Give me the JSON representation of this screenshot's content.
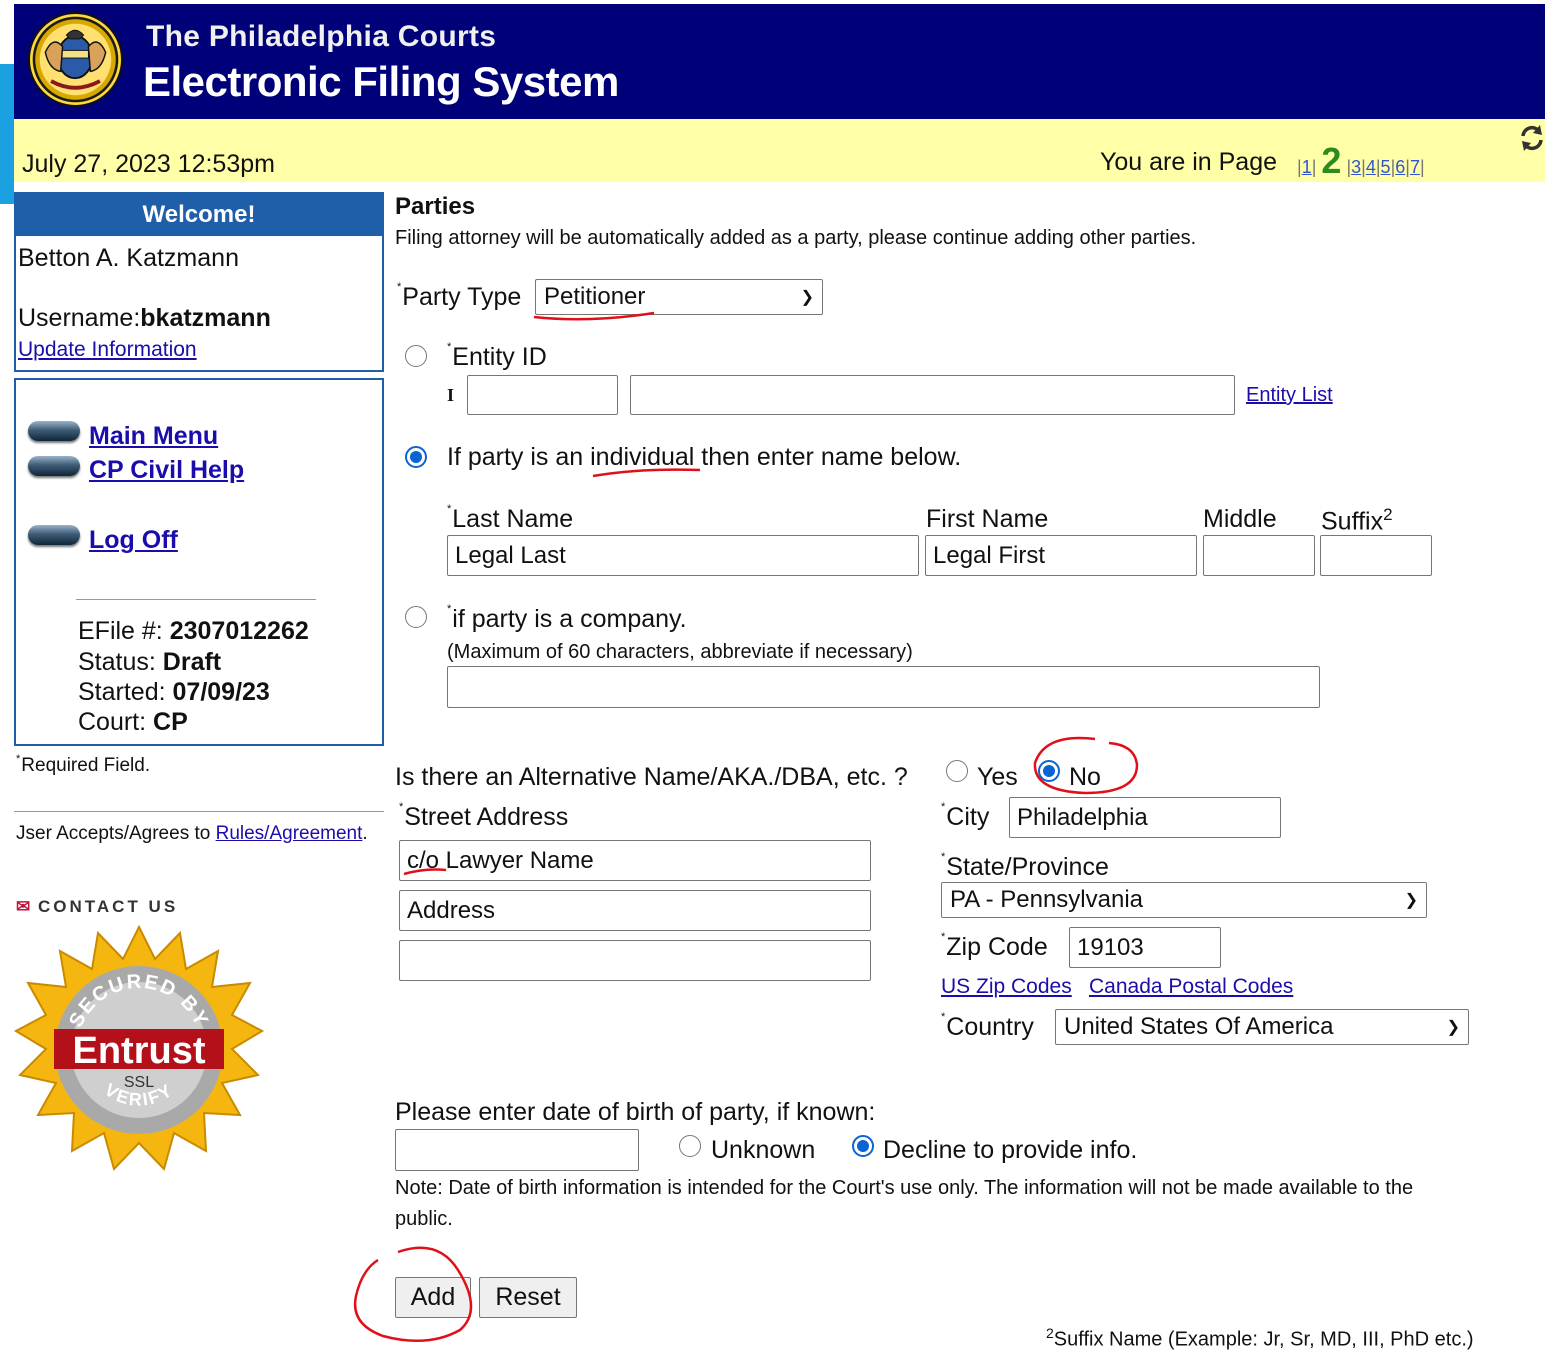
{
  "header": {
    "subtitle": "The Philadelphia Courts",
    "title": "Electronic Filing System"
  },
  "topbar": {
    "datetime": "July 27, 2023 12:53pm",
    "page_label": "You are in Page",
    "pages": [
      "1",
      "2",
      "3",
      "4",
      "5",
      "6",
      "7"
    ],
    "current_page": "2"
  },
  "sidebar": {
    "welcome": "Welcome!",
    "user_name": "Betton A. Katzmann",
    "username_label": "Username:",
    "username": "bkatzmann",
    "update_info": "Update Information",
    "nav": {
      "main_menu": "Main Menu",
      "help": "CP Civil Help",
      "logoff": "Log Off"
    },
    "efile": {
      "number_label": "EFile #:",
      "number": "2307012262",
      "status_label": "Status:",
      "status": "Draft",
      "started_label": "Started:",
      "started": "07/09/23",
      "court_label": "Court:",
      "court": "CP"
    },
    "required_note": "Required Field.",
    "agree_prefix": "Jser Accepts/Agrees to ",
    "agree_link": "Rules/Agreement",
    "agree_suffix": ".",
    "contact": "CONTACT US",
    "ssl_badge": {
      "top": "SECURED BY",
      "brand": "Entrust",
      "mid": "SSL",
      "bottom": "VERIFY"
    }
  },
  "form": {
    "section_title": "Parties",
    "section_note": "Filing attorney will be automatically added as a party, please continue adding other parties.",
    "party_type_label": "Party Type",
    "party_type_value": "Petitioner",
    "entity_id_label": "Entity ID",
    "entity_prefix": "I",
    "entity_list_link": "Entity List",
    "individual_label": "If party is an individual then enter name below.",
    "last_name_label": "Last Name",
    "first_name_label": "First Name",
    "middle_label": "Middle",
    "suffix_label": "Suffix",
    "suffix_sup": "2",
    "last_name_value": "Legal Last",
    "first_name_value": "Legal First",
    "middle_value": "",
    "suffix_value": "",
    "company_label": "if party is a company.",
    "company_note": "(Maximum of 60 characters, abbreviate if necessary)",
    "company_value": "",
    "alt_name_question": "Is there an Alternative Name/AKA./DBA, etc. ?",
    "alt_yes": "Yes",
    "alt_no": "No",
    "alt_selected": "No",
    "street_label": "Street Address",
    "street1": "c/o Lawyer Name",
    "street2": "Address",
    "street3": "",
    "city_label": "City",
    "city_value": "Philadelphia",
    "state_label": "State/Province",
    "state_value": "PA - Pennsylvania",
    "zip_label": "Zip Code",
    "zip_value": "19103",
    "us_zip_link": "US Zip Codes",
    "canada_link": "Canada Postal Codes",
    "country_label": "Country",
    "country_value": "United States Of America",
    "dob_label": "Please enter date of birth of party, if known:",
    "dob_value": "",
    "dob_unknown": "Unknown",
    "dob_decline": "Decline to provide info.",
    "dob_selected": "Decline to provide info.",
    "dob_note_1": "Note: Date of birth information is intended for the Court's use only. The information will not be made available to the",
    "dob_note_2": "public.",
    "add_button": "Add",
    "reset_button": "Reset",
    "footnote_sup": "2",
    "footnote": "Suffix Name (Example: Jr, Sr, MD, III, PhD etc.)"
  },
  "colors": {
    "header_bg": "#000078",
    "topbar_bg": "#ffffa8",
    "sidebar_accent": "#1f5ea8",
    "current_page": "#2d8a1e",
    "annotation": "#e0101a",
    "radio_selected": "#0b63d6"
  }
}
